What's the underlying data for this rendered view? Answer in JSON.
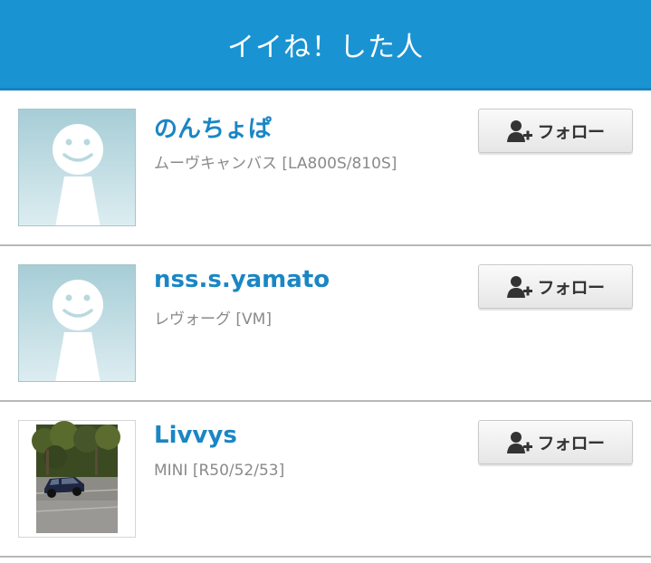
{
  "header": {
    "title": "イイね！した人"
  },
  "users": [
    {
      "name": "のんちょぱ",
      "car": "ムーヴキャンバス [LA800S/810S]",
      "avatar": "default-avatar-icon",
      "follow_label": "フォロー"
    },
    {
      "name": "nss.s.yamato",
      "car": "レヴォーグ [VM]",
      "avatar": "default-avatar-icon",
      "follow_label": "フォロー"
    },
    {
      "name": "Livvys",
      "car": "MINI [R50/52/53]",
      "avatar": "car-photo",
      "follow_label": "フォロー"
    }
  ],
  "colors": {
    "header_bg": "#1a93d2",
    "name_link": "#1a86c4",
    "subtext": "#8a8a8a"
  },
  "icons": {
    "follow": "add-user-icon"
  }
}
